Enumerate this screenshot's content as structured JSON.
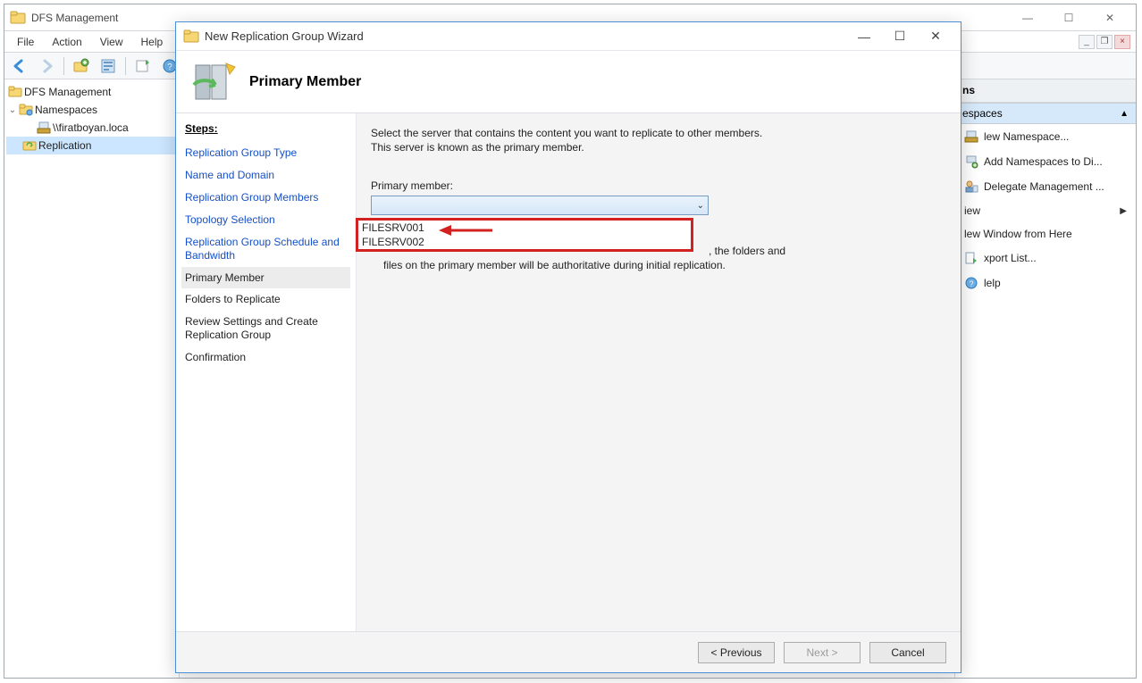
{
  "parent": {
    "title": "DFS Management",
    "menus": {
      "file": "File",
      "action": "Action",
      "view": "View",
      "help": "Help"
    },
    "tree": {
      "root": "DFS Management",
      "namespaces": "Namespaces",
      "namespace_item": "\\\\firatboyan.loca",
      "replication": "Replication"
    }
  },
  "actions": {
    "header": "ns",
    "section": "espaces",
    "items": {
      "new_namespace": "lew Namespace...",
      "add_namespaces": "Add Namespaces to Di...",
      "delegate": "Delegate Management ...",
      "view": "iew",
      "new_window": "lew Window from Here",
      "export_list": "xport List...",
      "help": "lelp"
    }
  },
  "wizard": {
    "title": "New Replication Group Wizard",
    "page_title": "Primary Member",
    "steps_heading": "Steps:",
    "steps": {
      "type": "Replication Group Type",
      "name": "Name and Domain",
      "members": "Replication Group Members",
      "topology": "Topology Selection",
      "schedule": "Replication Group Schedule and Bandwidth",
      "primary": "Primary Member",
      "folders": "Folders to Replicate",
      "review": "Review Settings and Create Replication Group",
      "confirm": "Confirmation"
    },
    "content": {
      "intro1": "Select the server that contains the content you want to replicate to other members.",
      "intro2": "This server is known as the primary member.",
      "field_label": "Primary member:",
      "behind_right": ", the folders and",
      "behind_below": "files on the primary member will be authoritative during initial replication."
    },
    "dropdown": {
      "opt1": "FILESRV001",
      "opt2": "FILESRV002"
    },
    "buttons": {
      "previous": "< Previous",
      "next": "Next >",
      "cancel": "Cancel"
    }
  }
}
